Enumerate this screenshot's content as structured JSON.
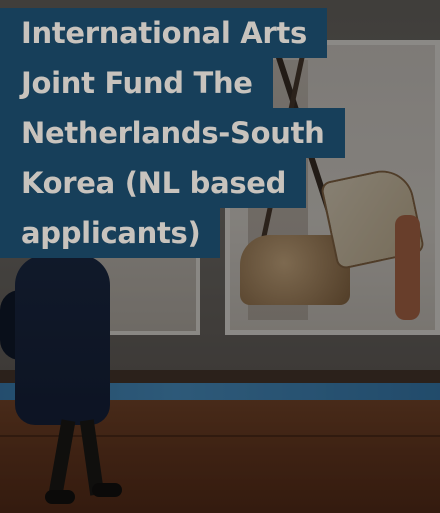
{
  "card": {
    "title_lines": [
      "International Arts",
      "Joint Fund The",
      "Netherlands-South",
      "Korea (NL based",
      "applicants)"
    ],
    "title_background_color": "#173f5a",
    "title_text_color": "#c8c3bd"
  }
}
